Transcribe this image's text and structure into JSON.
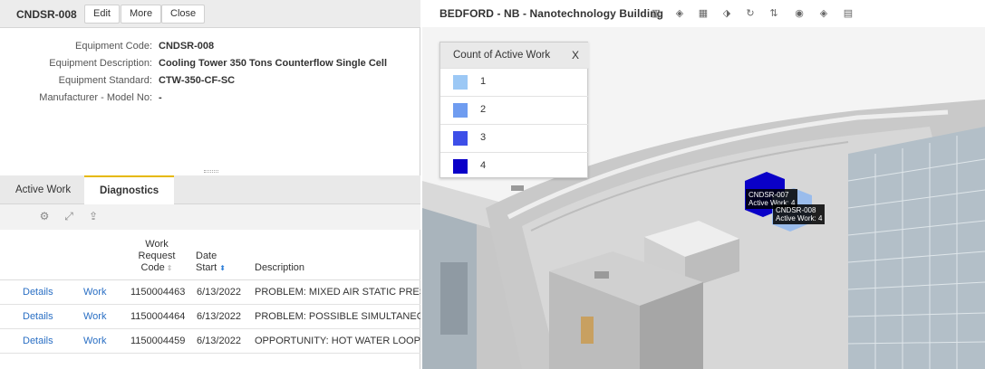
{
  "record": {
    "title": "CNDSR-008",
    "buttons": {
      "edit": "Edit",
      "more": "More",
      "close": "Close"
    }
  },
  "fields": [
    {
      "label": "Equipment Code:",
      "value": "CNDSR-008"
    },
    {
      "label": "Equipment Description:",
      "value": "Cooling Tower 350 Tons Counterflow Single Cell"
    },
    {
      "label": "Equipment Standard:",
      "value": "CTW-350-CF-SC"
    },
    {
      "label": "Manufacturer - Model No:",
      "value": "-"
    }
  ],
  "tabs": [
    {
      "label": "Active Work",
      "active": false
    },
    {
      "label": "Diagnostics",
      "active": true
    }
  ],
  "toolbar_icons": [
    "gear-icon",
    "expand-icon",
    "export-icon"
  ],
  "table": {
    "headers": {
      "work_request_code": "Work Request Code",
      "date_start": "Date Start",
      "description": "Description"
    },
    "rows": [
      {
        "details": "Details",
        "work": "Work",
        "code": "1150004463",
        "date": "6/13/2022",
        "description": "PROBLEM: MIXED AIR STATIC PRESSURE"
      },
      {
        "details": "Details",
        "work": "Work",
        "code": "1150004464",
        "date": "6/13/2022",
        "description": "PROBLEM: POSSIBLE SIMULTANEOUS OF"
      },
      {
        "details": "Details",
        "work": "Work",
        "code": "1150004459",
        "date": "6/13/2022",
        "description": "OPPORTUNITY: HOT WATER LOOP TEMP"
      }
    ]
  },
  "viewer": {
    "title": "BEDFORD - NB - Nanotechnology Building",
    "icons": [
      "book-icon",
      "layers-icon",
      "grid-icon",
      "tag-icon",
      "rotate-icon",
      "route-icon",
      "eye-icon",
      "hide-icon",
      "clipboard-icon"
    ],
    "legend": {
      "title": "Count of Active Work",
      "close": "X",
      "items": [
        {
          "label": "1",
          "color": "#9cc8f5"
        },
        {
          "label": "2",
          "color": "#6f9cf0"
        },
        {
          "label": "3",
          "color": "#3d4fe8"
        },
        {
          "label": "4",
          "color": "#0a00c8"
        }
      ]
    },
    "tags": [
      {
        "line1": "CNDSR-007",
        "line2": "Active Work: 4"
      },
      {
        "line1": "CNDSR-008",
        "line2": "Active Work: 4"
      }
    ]
  }
}
